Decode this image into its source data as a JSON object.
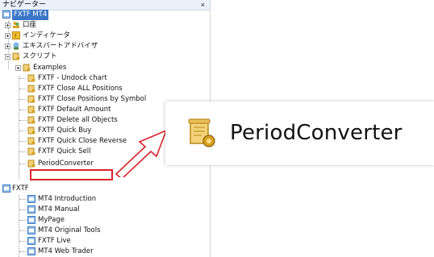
{
  "window": {
    "title": "ナビゲーター",
    "close": "×"
  },
  "tree": {
    "account": "FXTF MT4",
    "accounts_node": "口座",
    "indicators_node": "インディケータ",
    "experts_node": "エキスパートアドバイザ",
    "scripts_node": "スクリプト",
    "scripts": [
      "Examples",
      "FXTF - Undock chart",
      "FXTF Close ALL Positions",
      "FXTF Close Positions by Symbol",
      "FXTF Default Amount",
      "FXTF Delete all Objects",
      "FXTF Quick Buy",
      "FXTF Quick Close Reverse",
      "FXTF Quick Sell",
      "PeriodConverter"
    ],
    "fxtf_root": "FXTF",
    "links": [
      "MT4 Introduction",
      "MT4 Manual",
      "MyPage",
      "MT4 Original Tools",
      "FXTF Live",
      "MT4 Web Trader"
    ]
  },
  "zoom": {
    "label": "PeriodConverter"
  },
  "colors": {
    "highlight": "#d9252a",
    "selection": "#3b76c8"
  }
}
